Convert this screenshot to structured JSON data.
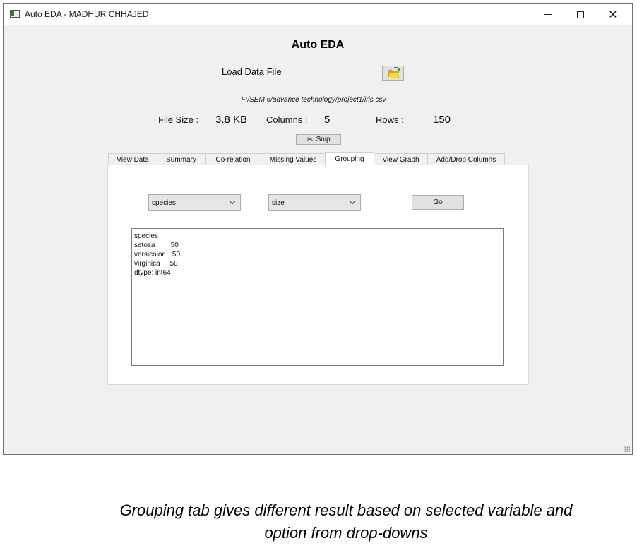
{
  "window": {
    "title": "Auto EDA - MADHUR CHHAJED"
  },
  "header": {
    "title": "Auto EDA"
  },
  "load": {
    "label": "Load Data File"
  },
  "file": {
    "path": "F:/SEM 6/advance technology/project1/iris.csv",
    "size_label": "File Size :",
    "size_value": "3.8 KB",
    "columns_label": "Columns :",
    "columns_value": "5",
    "rows_label": "Rows :",
    "rows_value": "150"
  },
  "snip": {
    "label": "Snip"
  },
  "tabs": [
    {
      "label": "View Data"
    },
    {
      "label": "Summary"
    },
    {
      "label": "Co-relation"
    },
    {
      "label": "Missing Values"
    },
    {
      "label": "Grouping"
    },
    {
      "label": "View Graph"
    },
    {
      "label": "Add/Drop Columns"
    }
  ],
  "active_tab": "Grouping",
  "grouping": {
    "variable_select": "species",
    "option_select": "size",
    "go_label": "Go",
    "output_lines": [
      "species",
      "setosa        50",
      "versicolor    50",
      "virginica     50",
      "dtype: int64"
    ]
  },
  "caption": {
    "line1": "Grouping tab gives different result based on selected variable and",
    "line2": "option from drop-downs"
  }
}
